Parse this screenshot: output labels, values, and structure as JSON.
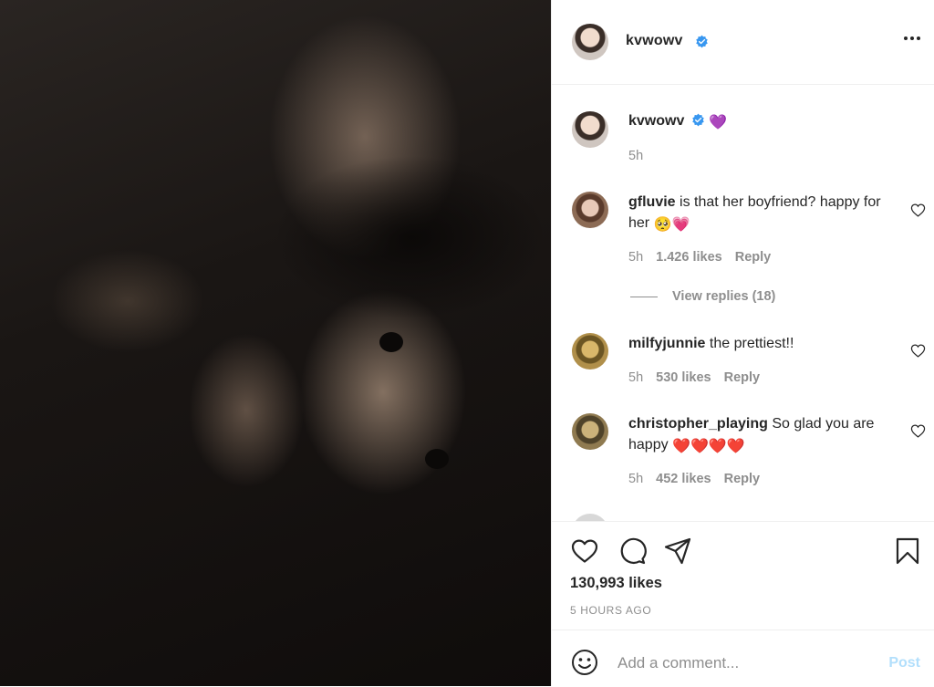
{
  "post": {
    "username": "kvwowv",
    "caption_emoji": "💜",
    "caption_time": "5h",
    "likes": "130,993 likes",
    "time_ago": "5 HOURS AGO"
  },
  "comments": [
    {
      "username": "gfluvie",
      "text": "is that her boyfriend? happy for her",
      "emoji": "🥺💗",
      "time": "5h",
      "likes": "1.426 likes",
      "reply": "Reply",
      "view_replies": "View replies (18)"
    },
    {
      "username": "milfyjunnie",
      "text": "the prettiest!!",
      "emoji": "",
      "time": "5h",
      "likes": "530 likes",
      "reply": "Reply"
    },
    {
      "username": "christopher_playing",
      "text": "So glad you are happy",
      "emoji": "❤️❤️❤️❤️",
      "time": "5h",
      "likes": "452 likes",
      "reply": "Reply"
    }
  ],
  "add_comment": {
    "placeholder": "Add a comment...",
    "post_label": "Post"
  },
  "icons": {
    "verified": "verified-badge-icon",
    "more": "more-options-icon",
    "like": "heart-icon",
    "comment": "comment-bubble-icon",
    "share": "paper-plane-icon",
    "save": "bookmark-icon",
    "emoji": "smiley-icon"
  },
  "colors": {
    "verified_blue": "#3897f0",
    "post_button_disabled": "#b2dffc",
    "secondary_text": "#8e8e8e"
  }
}
